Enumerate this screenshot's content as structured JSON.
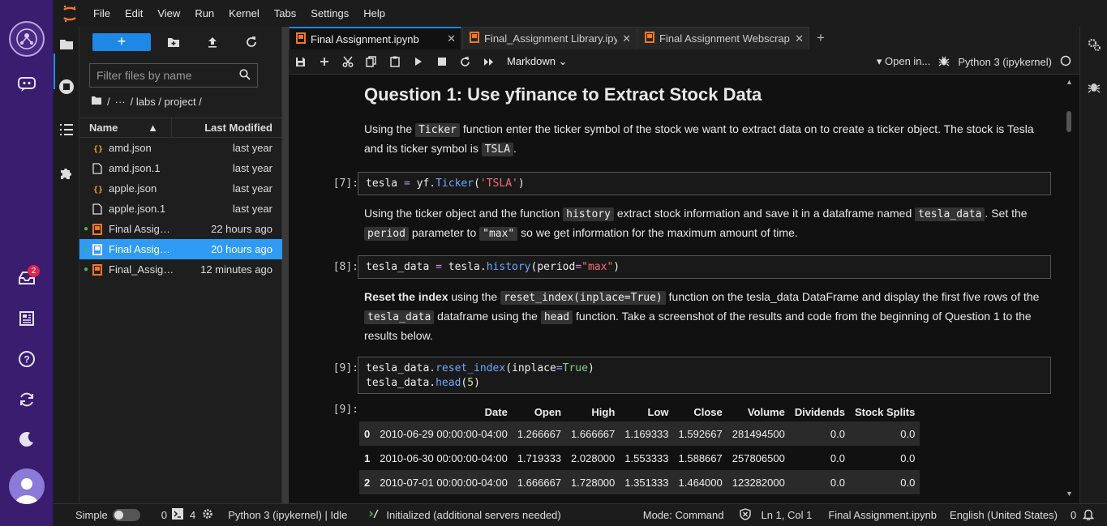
{
  "menu": [
    "File",
    "Edit",
    "View",
    "Run",
    "Kernel",
    "Tabs",
    "Settings",
    "Help"
  ],
  "rail": {
    "notification_count": "2"
  },
  "filebrowser": {
    "filter_placeholder": "Filter files by name",
    "crumbs": {
      "root": "/",
      "ellipsis": "···",
      "path": "/ labs / project /"
    },
    "header": {
      "name": "Name",
      "modified": "Last Modified"
    },
    "files": [
      {
        "name": "amd.json",
        "modified": "last year",
        "icon": "json-icon",
        "running": false,
        "selected": false
      },
      {
        "name": "amd.json.1",
        "modified": "last year",
        "icon": "file-icon",
        "running": false,
        "selected": false
      },
      {
        "name": "apple.json",
        "modified": "last year",
        "icon": "json-icon",
        "running": false,
        "selected": false
      },
      {
        "name": "apple.json.1",
        "modified": "last year",
        "icon": "file-icon",
        "running": false,
        "selected": false
      },
      {
        "name": "Final Assig…",
        "modified": "22 hours ago",
        "icon": "notebook-icon",
        "running": true,
        "selected": false
      },
      {
        "name": "Final Assig…",
        "modified": "20 hours ago",
        "icon": "notebook-icon",
        "running": true,
        "selected": true
      },
      {
        "name": "Final_Assig…",
        "modified": "12 minutes ago",
        "icon": "notebook-icon",
        "running": true,
        "selected": false
      }
    ]
  },
  "tabs": [
    {
      "label": "Final Assignment.ipynb",
      "active": true
    },
    {
      "label": "Final_Assignment Library.ipyı",
      "active": false
    },
    {
      "label": "Final Assignment Webscrapin",
      "active": false
    }
  ],
  "toolbar": {
    "cell_type": "Markdown",
    "open_in": "Open in...",
    "kernel": "Python 3 (ipykernel)"
  },
  "notebook": {
    "heading": "Question 1: Use yfinance to Extract Stock Data",
    "p1_a": "Using the ",
    "p1_code": "Ticker",
    "p1_b": " function enter the ticker symbol of the stock we want to extract data on to create a ticker object. The stock is Tesla and its ticker symbol is ",
    "p1_code2": "TSLA",
    "p1_c": ".",
    "cell7_prompt": "[7]:",
    "p2_a": "Using the ticker object and the function ",
    "p2_code": "history",
    "p2_b": " extract stock information and save it in a dataframe named ",
    "p2_code2": "tesla_data",
    "p2_c": ". Set the ",
    "p2_code3": "period",
    "p2_d": " parameter to ",
    "p2_code4": "\"max\"",
    "p2_e": " so we get information for the maximum amount of time.",
    "cell8_prompt": "[8]:",
    "p3_bold": "Reset the index",
    "p3_a": " using the ",
    "p3_code": "reset_index(inplace=True)",
    "p3_b": " function on the tesla_data DataFrame and display the first five rows of the ",
    "p3_code2": "tesla_data",
    "p3_c": " dataframe using the ",
    "p3_code3": "head",
    "p3_d": " function. Take a screenshot of the results and code from the beginning of Question 1 to the results below.",
    "cell9_prompt": "[9]:",
    "out9_prompt": "[9]:",
    "table": {
      "columns": [
        "",
        "Date",
        "Open",
        "High",
        "Low",
        "Close",
        "Volume",
        "Dividends",
        "Stock Splits"
      ],
      "rows": [
        [
          "0",
          "2010-06-29 00:00:00-04:00",
          "1.266667",
          "1.666667",
          "1.169333",
          "1.592667",
          "281494500",
          "0.0",
          "0.0"
        ],
        [
          "1",
          "2010-06-30 00:00:00-04:00",
          "1.719333",
          "2.028000",
          "1.553333",
          "1.588667",
          "257806500",
          "0.0",
          "0.0"
        ],
        [
          "2",
          "2010-07-01 00:00:00-04:00",
          "1.666667",
          "1.728000",
          "1.351333",
          "1.464000",
          "123282000",
          "0.0",
          "0.0"
        ]
      ]
    }
  },
  "status": {
    "mode_simple": "Simple",
    "terminals": "0",
    "kernels": "4",
    "kernel_status": "Python 3 (ipykernel) | Idle",
    "lsp": "Initialized (additional servers needed)",
    "mode": "Mode: Command",
    "position": "Ln 1, Col 1",
    "file": "Final Assignment.ipynb",
    "language": "English (United States)",
    "notifications": "0"
  },
  "colors": {
    "accent": "#1e88e5",
    "rail": "#3a1d6e",
    "selected_row": "#2f9bf5"
  }
}
